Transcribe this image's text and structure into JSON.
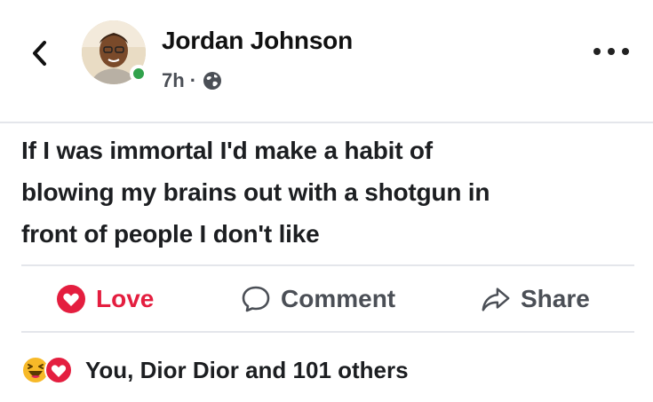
{
  "post": {
    "author": "Jordan Johnson",
    "time": "7h",
    "meta_separator": "·",
    "text_lines": [
      "If I was immortal I'd make a habit of",
      "blowing my brains out with a shotgun in",
      "front of people I don't like"
    ]
  },
  "actions": {
    "love_label": "Love",
    "comment_label": "Comment",
    "share_label": "Share"
  },
  "reactions": {
    "summary": "You, Dior Dior and 101 others"
  },
  "icons": {
    "back": "chevron-left-icon",
    "more": "more-horizontal-icon",
    "audience": "globe-icon",
    "love": "heart-icon",
    "comment": "comment-bubble-icon",
    "share": "share-arrow-icon",
    "reaction_haha": "haha-icon",
    "reaction_love": "love-reaction-icon"
  },
  "colors": {
    "love_red": "#e41e3f",
    "online_green": "#31a24c",
    "text_dark": "#1c1e21",
    "text_muted": "#4b4f56",
    "divider": "#e4e6eb",
    "haha_yellow": "#f7b928"
  }
}
